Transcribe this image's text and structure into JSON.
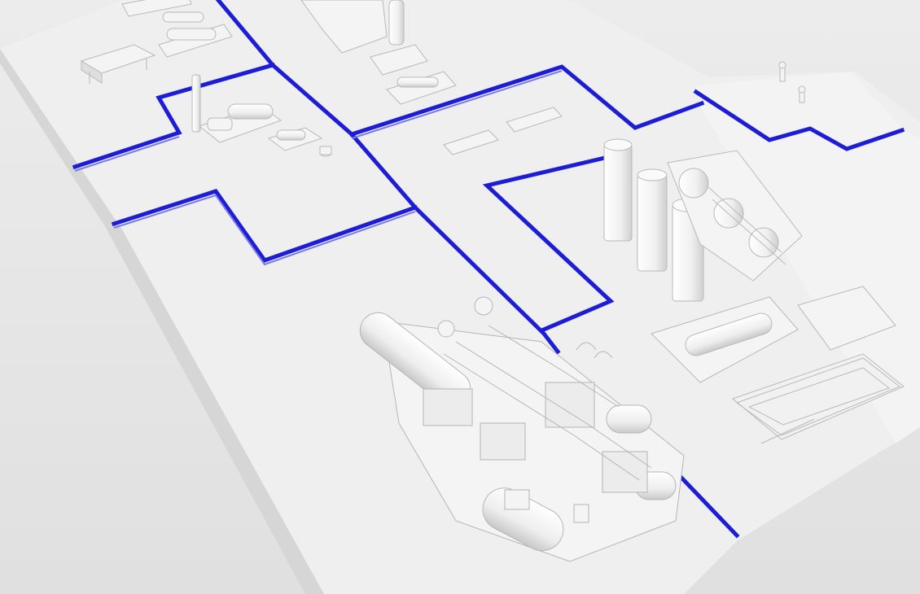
{
  "scene": {
    "subject": "",
    "colors": {
      "background": "#e7e7e7",
      "platform": "#efefef",
      "platform_shade": "#dcdcdc",
      "equipment": "#f4f4f4",
      "equipment_stroke": "#b9b9b9",
      "boundary_line": "#1d1dd6"
    }
  }
}
